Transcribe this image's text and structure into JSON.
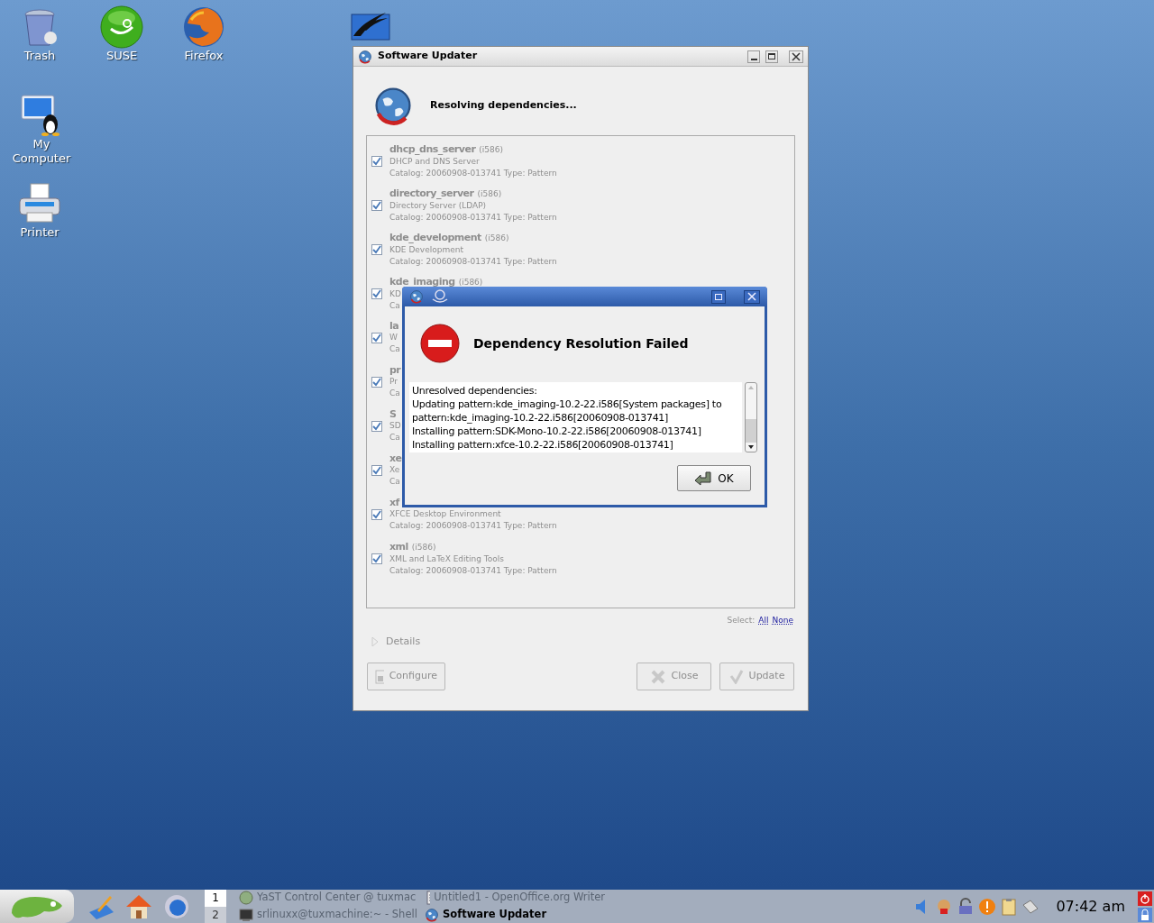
{
  "desktop_icons": [
    {
      "kind": "trash",
      "label": "Trash"
    },
    {
      "kind": "suse",
      "label": "SUSE"
    },
    {
      "kind": "firefox",
      "label": "Firefox"
    },
    {
      "kind": "computer",
      "label": "My Computer"
    },
    {
      "kind": "printer",
      "label": "Printer"
    },
    {
      "kind": "office"
    }
  ],
  "updater": {
    "title": "Software Updater",
    "status": "Resolving dependencies...",
    "items": [
      {
        "name": "dhcp_dns_server",
        "arch": "(i586)",
        "description": "DHCP and DNS Server",
        "catalog": "Catalog: 20060908-013741 Type: Pattern",
        "checked": true
      },
      {
        "name": "directory_server",
        "arch": "(i586)",
        "description": "Directory Server (LDAP)",
        "catalog": "Catalog: 20060908-013741 Type: Pattern",
        "checked": true
      },
      {
        "name": "kde_development",
        "arch": "(i586)",
        "description": "KDE Development",
        "catalog": "Catalog: 20060908-013741 Type: Pattern",
        "checked": true
      },
      {
        "name": "kde_imaging",
        "arch": "(i586)",
        "description": "KD",
        "catalog": "Ca",
        "checked": true
      },
      {
        "name": "la",
        "description": "W",
        "catalog": "Ca",
        "checked": true
      },
      {
        "name": "pr",
        "description": "Pr",
        "catalog": "Ca",
        "checked": true
      },
      {
        "name": "S",
        "description": "SD",
        "catalog": "Ca",
        "checked": true
      },
      {
        "name": "xe",
        "description": "Xe",
        "catalog": "Ca",
        "checked": true
      },
      {
        "name": "xf",
        "description": "XFCE Desktop Environment",
        "catalog": "Catalog: 20060908-013741 Type: Pattern",
        "checked": true
      },
      {
        "name": "xml",
        "arch": "(i586)",
        "description": "XML and LaTeX Editing Tools",
        "catalog": "Catalog: 20060908-013741 Type: Pattern",
        "checked": true
      }
    ],
    "select_label": "Select:",
    "select_links": [
      "All",
      "None"
    ],
    "details": {
      "label": "Details",
      "expanded": false
    },
    "buttons": [
      {
        "kind": "configure",
        "label": "Configure",
        "disabled": true
      },
      {
        "kind": "close",
        "label": "Close",
        "disabled": true
      },
      {
        "kind": "update",
        "label": "Update",
        "disabled": true
      }
    ]
  },
  "dialog": {
    "heading": "Dependency Resolution Failed",
    "message": [
      "Unresolved dependencies:",
      "Updating pattern:kde_imaging-10.2-22.i586[System packages] to",
      "pattern:kde_imaging-10.2-22.i586[20060908-013741]",
      "Installing pattern:SDK-Mono-10.2-22.i586[20060908-013741]",
      "Installing pattern:xfce-10.2-22.i586[20060908-013741]"
    ],
    "ok": "OK"
  },
  "taskbar": {
    "pager": [
      {
        "label": "1",
        "selected": true
      },
      {
        "label": "2",
        "selected": false
      }
    ],
    "tasks": [
      {
        "kind": "yast",
        "label": "YaST Control Center @ tuxmac",
        "active": false
      },
      {
        "kind": "shell",
        "label": "srlinuxx@tuxmachine:~ - Shell",
        "active": false
      },
      {
        "kind": "writer",
        "label": "Untitled1 - OpenOffice.org Writer",
        "active": false
      },
      {
        "kind": "globe",
        "label": "Software Updater",
        "active": true
      }
    ],
    "clock": "07:42 am"
  }
}
